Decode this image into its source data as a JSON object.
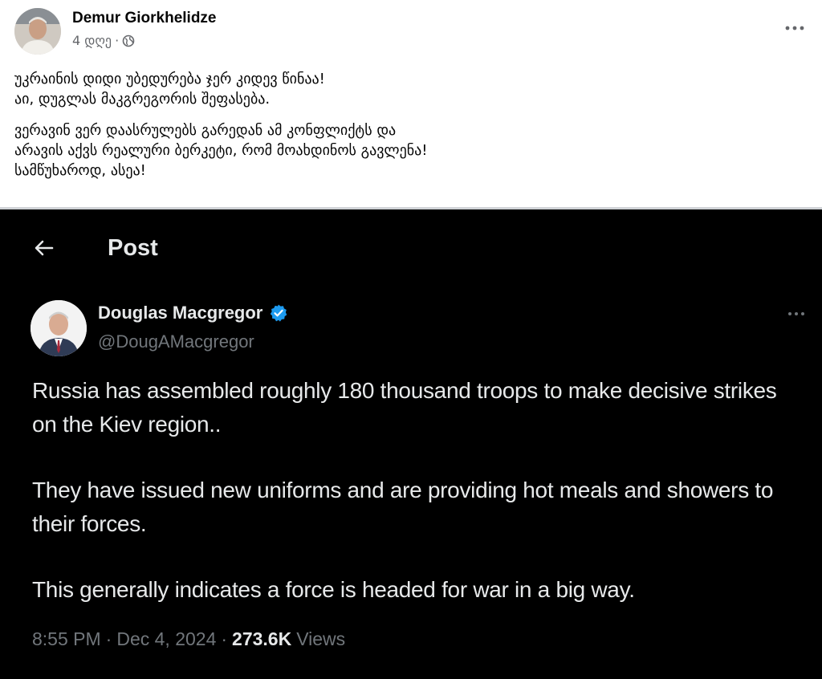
{
  "post": {
    "author": "Demur Giorkhelidze",
    "time": "4 დღე",
    "separator": "·",
    "paragraphs": [
      "უკრაინის დიდი უბედურება ჯერ კიდევ წინაა!\nაი, დუგლას მაკგრეგორის შეფასება.",
      "ვერავინ ვერ დაასრულებს გარედან ამ კონფლიქტს და\nარავის აქვს რეალური ბერკეტი, რომ მოახდინოს გავლენა!\nსამწუხაროდ, ასეა!"
    ],
    "icons": {
      "privacy": "globe-icon",
      "menu": "more-dots-icon"
    }
  },
  "tweet": {
    "header_title": "Post",
    "author_name": "Douglas Macgregor",
    "handle": "@DougAMacgregor",
    "paragraphs": [
      "Russia has assembled roughly 180 thousand troops to make decisive strikes on the Kiev region..",
      "They have issued new uniforms and are providing hot meals and showers to their forces.",
      "This generally indicates a force is headed for war in a big way."
    ],
    "time": "8:55 PM",
    "date": "Dec 4, 2024",
    "dot": "·",
    "views_count": "273.6K",
    "views_label": "Views",
    "colors": {
      "background": "#000000",
      "verified": "#1d9bf0",
      "text": "#e7e9ea",
      "muted": "#71767b"
    },
    "icons": {
      "back": "arrow-left-icon",
      "verified": "verified-badge-icon",
      "menu": "more-dots-icon"
    }
  }
}
